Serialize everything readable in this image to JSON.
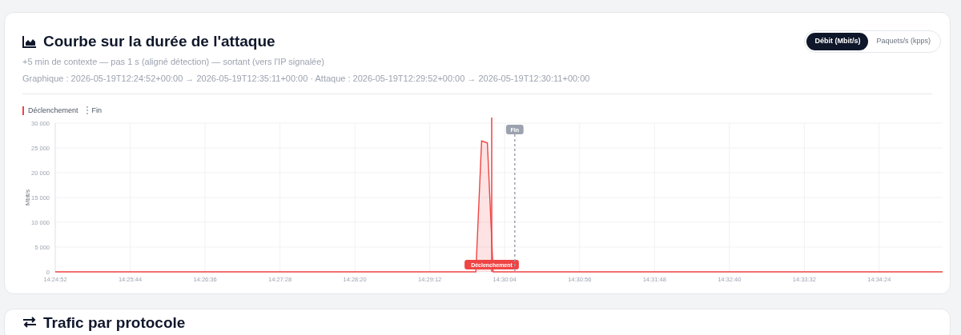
{
  "card": {
    "title": "Courbe sur la durée de l'attaque",
    "subtitle": "+5 min de contexte — pas 1 s (aligné détection) — sortant (vers l'IP signalée)",
    "range": "Graphique : 2026-05-19T12:24:52+00:00 → 2026-05-19T12:35:11+00:00 · Attaque : 2026-05-19T12:29:52+00:00 → 2026-05-19T12:30:11+00:00",
    "toggle": [
      {
        "label": "Débit (Mbit/s)",
        "selected": true
      },
      {
        "label": "Paquets/s (kpps)",
        "selected": false
      }
    ],
    "legend": [
      {
        "label": "Déclenchement",
        "kind": "trigger"
      },
      {
        "label": "Fin",
        "kind": "end"
      }
    ],
    "chart_data": {
      "type": "area",
      "ylabel": "Mbit/s",
      "categories": [
        "14:24:52",
        null,
        null,
        null,
        null,
        null,
        null,
        null,
        null,
        null,
        null,
        null,
        null,
        "14:25:44",
        null,
        null,
        null,
        null,
        null,
        null,
        null,
        null,
        null,
        null,
        null,
        null,
        "14:26:36",
        null,
        null,
        null,
        null,
        null,
        null,
        null,
        null,
        null,
        null,
        null,
        null,
        "14:27:28",
        null,
        null,
        null,
        null,
        null,
        null,
        null,
        null,
        null,
        null,
        null,
        null,
        "14:28:20",
        null,
        null,
        null,
        null,
        null,
        null,
        null,
        null,
        null,
        null,
        null,
        null,
        "14:29:12",
        null,
        null,
        null,
        null,
        null,
        null,
        null,
        null,
        null,
        null,
        null,
        null,
        "14:30:04",
        null,
        null,
        null,
        null,
        null,
        null,
        null,
        null,
        null,
        null,
        null,
        null,
        "14:30:56",
        null,
        null,
        null,
        null,
        null,
        null,
        null,
        null,
        null,
        null,
        null,
        null,
        "14:31:48",
        null,
        null,
        null,
        null,
        null,
        null,
        null,
        null,
        null,
        null,
        null,
        null,
        "14:32:40",
        null,
        null,
        null,
        null,
        null,
        null,
        null,
        null,
        null,
        null,
        null,
        null,
        "14:33:32",
        null,
        null,
        null,
        null,
        null,
        null,
        null,
        null,
        null,
        null,
        null,
        null,
        "14:34:24",
        null,
        null,
        null,
        null,
        null,
        null,
        null,
        null,
        null,
        null,
        null
      ],
      "grid": true,
      "values": [
        0,
        0,
        0,
        0,
        0,
        0,
        0,
        0,
        0,
        0,
        0,
        0,
        0,
        0,
        0,
        0,
        0,
        0,
        0,
        0,
        0,
        0,
        0,
        0,
        0,
        0,
        0,
        0,
        0,
        0,
        0,
        0,
        0,
        0,
        0,
        0,
        0,
        0,
        0,
        0,
        0,
        0,
        0,
        0,
        0,
        0,
        0,
        0,
        0,
        0,
        0,
        0,
        0,
        0,
        0,
        0,
        0,
        0,
        0,
        0,
        0,
        0,
        0,
        0,
        0,
        0,
        0,
        0,
        0,
        0,
        0,
        0,
        0,
        0,
        26400,
        26000,
        0,
        0,
        0,
        0,
        0,
        0,
        0,
        0,
        0,
        0,
        0,
        0,
        0,
        0,
        0,
        0,
        0,
        0,
        0,
        0,
        0,
        0,
        0,
        0,
        0,
        0,
        0,
        0,
        0,
        0,
        0,
        0,
        0,
        0,
        0,
        0,
        0,
        0,
        0,
        0,
        0,
        0,
        0,
        0,
        0,
        0,
        0,
        0,
        0,
        0,
        0,
        0,
        0,
        0,
        0,
        0,
        0,
        0,
        0,
        0,
        0,
        0,
        0,
        0,
        0,
        0,
        0,
        0,
        0,
        0,
        0,
        0,
        0,
        0,
        0,
        0,
        0,
        0,
        0
      ],
      "ylim": [
        0,
        30000
      ],
      "yticks": [
        {
          "value": 0,
          "label": "0"
        },
        {
          "value": 5000,
          "label": "5 000"
        },
        {
          "value": 10000,
          "label": "10 000"
        },
        {
          "value": 15000,
          "label": "15 000"
        },
        {
          "value": 20000,
          "label": "20 000"
        },
        {
          "value": 25000,
          "label": "25 000"
        },
        {
          "value": 30000,
          "label": "30 000"
        }
      ],
      "annotations": [
        "Déclenchement",
        "Fin"
      ]
    }
  },
  "next_card": {
    "title": "Trafic par protocole"
  }
}
